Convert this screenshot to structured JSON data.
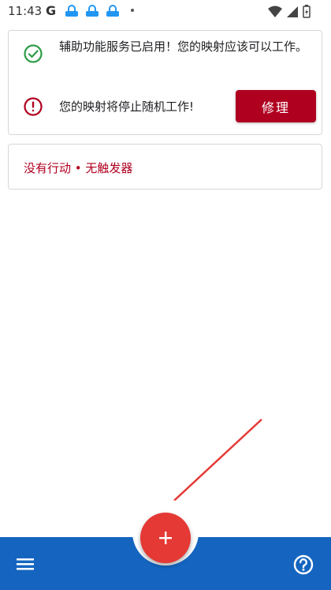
{
  "status_bar": {
    "time": "11:43",
    "g_label": "G",
    "icons": [
      "app-notification-icon",
      "app-notification-icon",
      "app-notification-icon",
      "more-notifications-dot",
      "wifi-icon",
      "signal-icon",
      "battery-icon"
    ]
  },
  "status_card": {
    "accessibility_message": "辅助功能服务已启用！您的映射应该可以工作。",
    "warning_message": "您的映射将停止随机工作!",
    "fix_button_label": "修理",
    "colors": {
      "success": "#2e9c46",
      "error": "#b00020"
    }
  },
  "triggers_card": {
    "empty_message": "没有行动 • 无触发器"
  },
  "bottom_bar": {
    "menu_icon": "menu-icon",
    "fab_icon": "plus-icon",
    "help_icon": "help-circle-icon",
    "colors": {
      "bar": "#1565c0",
      "fab": "#e53935"
    }
  }
}
